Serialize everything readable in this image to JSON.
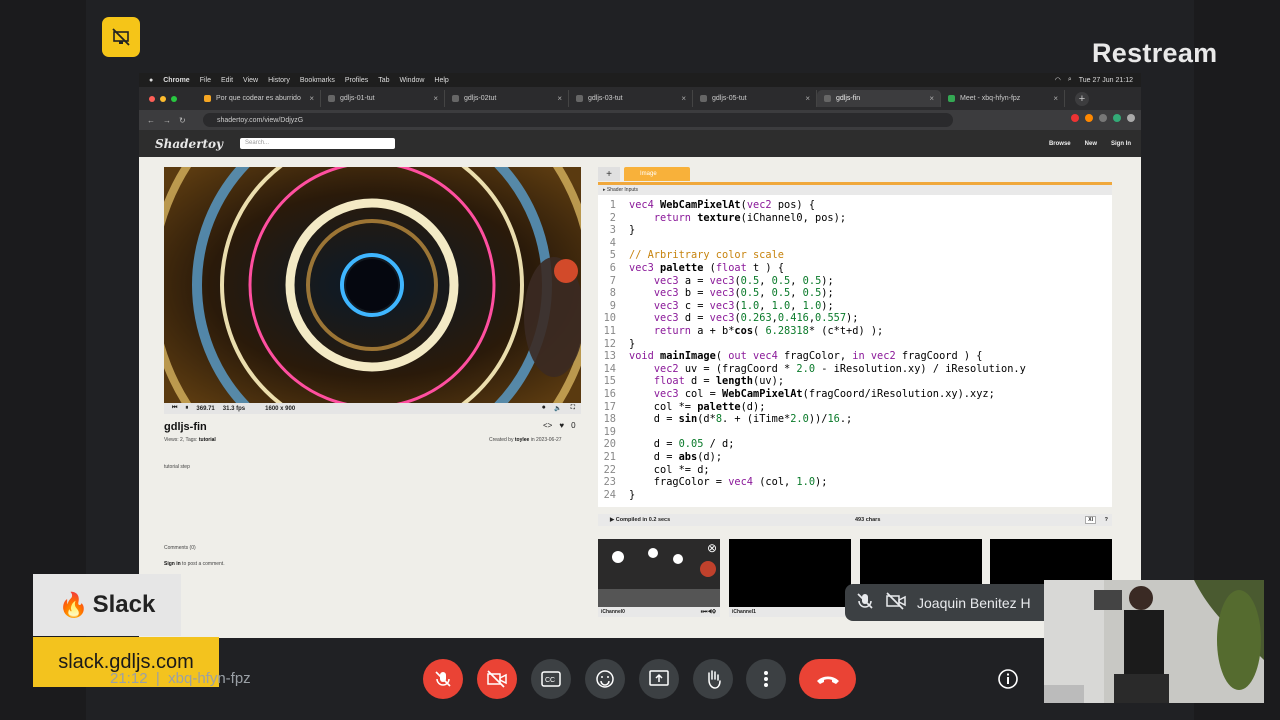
{
  "overlay": {
    "brand": "Restream"
  },
  "menubar": {
    "app": "Chrome",
    "items": [
      "File",
      "Edit",
      "View",
      "History",
      "Bookmarks",
      "Profiles",
      "Tab",
      "Window",
      "Help"
    ],
    "clock": "Tue 27 Jun  21:12"
  },
  "tabs": [
    {
      "label": "Por que codear es aburrido",
      "close": "×"
    },
    {
      "label": "gdljs-01-tut",
      "close": "×"
    },
    {
      "label": "gdljs-02tut",
      "close": "×"
    },
    {
      "label": "gdljs-03-tut",
      "close": "×"
    },
    {
      "label": "gdljs-05-tut",
      "close": "×"
    },
    {
      "label": "gdljs-fin",
      "close": "×"
    },
    {
      "label": "Meet - xbq-hfyn-fpz",
      "close": "×"
    }
  ],
  "newtab": "+",
  "address": {
    "url": "shadertoy.com/view/DdjyzG"
  },
  "shadertoy": {
    "logo": "Shadertoy",
    "search_placeholder": "Search...",
    "nav": [
      "Browse",
      "New",
      "Sign In"
    ],
    "player": {
      "time": "369.71",
      "fps": "31.3 fps",
      "resolution": "1600 x 900"
    },
    "title": "gdljs-fin",
    "views_prefix": "Views: 2, Tags: ",
    "tag": "tutorial",
    "created_prefix": "Created by ",
    "author": "toylee",
    "created_suffix": " in 2023-06-27",
    "likes": "0",
    "code_icon": "<>",
    "description": "tutorial step",
    "comments": "Comments (0)",
    "signin_link": "Sign in",
    "signin_suffix": " to post a comment."
  },
  "editor": {
    "plus": "+",
    "tab": "Image",
    "inputs": "Shader Inputs",
    "compiled": "Compiled in 0.2 secs",
    "chars": "493 chars",
    "font_size": "Xl",
    "help": "?",
    "lines": [
      {
        "n": "1",
        "text": "vec4 WebCamPixelAt(vec2 pos) {"
      },
      {
        "n": "2",
        "text": "    return texture(iChannel0, pos);"
      },
      {
        "n": "3",
        "text": "}"
      },
      {
        "n": "4",
        "text": ""
      },
      {
        "n": "5",
        "text": "// Arbritrary color scale"
      },
      {
        "n": "6",
        "text": "vec3 palette (float t ) {"
      },
      {
        "n": "7",
        "text": "    vec3 a = vec3(0.5, 0.5, 0.5);"
      },
      {
        "n": "8",
        "text": "    vec3 b = vec3(0.5, 0.5, 0.5);"
      },
      {
        "n": "9",
        "text": "    vec3 c = vec3(1.0, 1.0, 1.0);"
      },
      {
        "n": "10",
        "text": "    vec3 d = vec3(0.263,0.416,0.557);"
      },
      {
        "n": "11",
        "text": "    return a + b*cos( 6.28318* (c*t+d) );"
      },
      {
        "n": "12",
        "text": "}"
      },
      {
        "n": "13",
        "text": "void mainImage( out vec4 fragColor, in vec2 fragCoord ) {"
      },
      {
        "n": "14",
        "text": "    vec2 uv = (fragCoord * 2.0 - iResolution.xy) / iResolution.y"
      },
      {
        "n": "15",
        "text": "    float d = length(uv);"
      },
      {
        "n": "16",
        "text": "    vec3 col = WebCamPixelAt(fragCoord/iResolution.xy).xyz;"
      },
      {
        "n": "17",
        "text": "    col *= palette(d);"
      },
      {
        "n": "18",
        "text": "    d = sin(d*8. + (iTime*2.0))/16.;"
      },
      {
        "n": "19",
        "text": ""
      },
      {
        "n": "20",
        "text": "    d = 0.05 / d;"
      },
      {
        "n": "21",
        "text": "    d = abs(d);"
      },
      {
        "n": "22",
        "text": "    col *= d;"
      },
      {
        "n": "23",
        "text": "    fragColor = vec4 (col, 1.0);"
      },
      {
        "n": "24",
        "text": "}"
      }
    ],
    "channels": [
      "iChannel0",
      "iChannel1",
      "",
      ""
    ]
  },
  "meet": {
    "slack_label": "Slack",
    "slack_url": "slack.gdljs.com",
    "time": "21:12",
    "separator": "|",
    "code": "xbq-hfyn-fpz",
    "participant": "Joaquin Benitez H"
  },
  "colors": {
    "accent": "#f8b13a",
    "hangup": "#ea4335",
    "slack_yellow": "#f3c31e"
  }
}
